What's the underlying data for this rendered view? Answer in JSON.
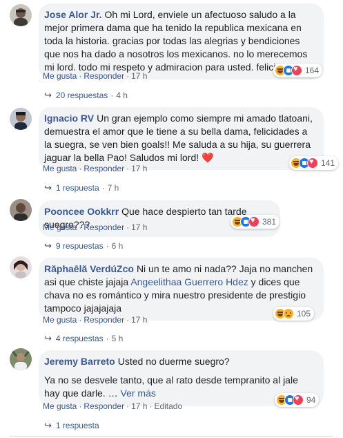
{
  "comments": [
    {
      "author": "Jose Alor Jr.",
      "text": "Oh mi Lord, enviele un afectuoso saludo a la mejor primera dama que ha tenido la republica mexicana en toda la historia. gracias por todas las alegrias y bendiciones que nos ha dado a nosotros los mexicanos. no lo merecemos mi lord. todo mi respeto y admiracion para usted. felicidades.",
      "like_label": "Me gusta",
      "reply_label": "Responder",
      "time": "17 h",
      "reaction_count": "164",
      "reaction_icons": [
        "haha-icon",
        "like-icon",
        "love-icon"
      ],
      "replies_label": "20 respuestas",
      "replies_time": "4 h"
    },
    {
      "author": "Ignacio RV",
      "text": "Un gran ejemplo como siempre mi amado tlatoani, demuestra el amor que le tiene a su bella dama, felicidades a la suegra, se ven bien goals!! Me saluda a su hija, su guerrera jaguar la bella Pao! Saludos mi lord!",
      "emoji": "❤️",
      "like_label": "Me gusta",
      "reply_label": "Responder",
      "time": "17 h",
      "reaction_count": "141",
      "reaction_icons": [
        "haha-icon",
        "like-icon",
        "love-icon"
      ],
      "replies_label": "1 respuesta",
      "replies_time": "7 h"
    },
    {
      "author": "Pooncee Ookkrr",
      "text": "Que hace despierto tan tarde suegro???",
      "like_label": "Me gusta",
      "reply_label": "Responder",
      "time": "17 h",
      "reaction_count": "381",
      "reaction_icons": [
        "haha-icon",
        "like-icon",
        "love-icon"
      ],
      "replies_label": "9 respuestas",
      "replies_time": "6 h"
    },
    {
      "author": "Răphaēlă VerdúZco",
      "text_before": "Ni un te amo ni nada?? Jaja no manchen asi que chiste jajaja",
      "mention": "Angeelithaa Guerrero Hdez",
      "text_after": "y dices que chava no es romántico y mira nuestro presidente de prestigio tampoco jajajajaja",
      "like_label": "Me gusta",
      "reply_label": "Responder",
      "time": "17 h",
      "reaction_count": "105",
      "reaction_icons": [
        "haha-icon",
        "sad-icon"
      ],
      "replies_label": "4 respuestas",
      "replies_time": "5 h"
    },
    {
      "author": "Jeremy Barreto",
      "text": "Usted no duerme suegro?",
      "text2": "Ya no se desvele tanto, que al rato desde tempranito al jale hay que darle.",
      "see_more": "Ver más",
      "like_label": "Me gusta",
      "reply_label": "Responder",
      "time": "17 h",
      "edited": "Editado",
      "reaction_count": "94",
      "reaction_icons": [
        "haha-icon",
        "like-icon",
        "love-icon"
      ],
      "replies_label": "1 respuesta"
    }
  ],
  "colors": {
    "link": "#385898",
    "bubble": "#f2f3f5",
    "meta": "#606770"
  }
}
